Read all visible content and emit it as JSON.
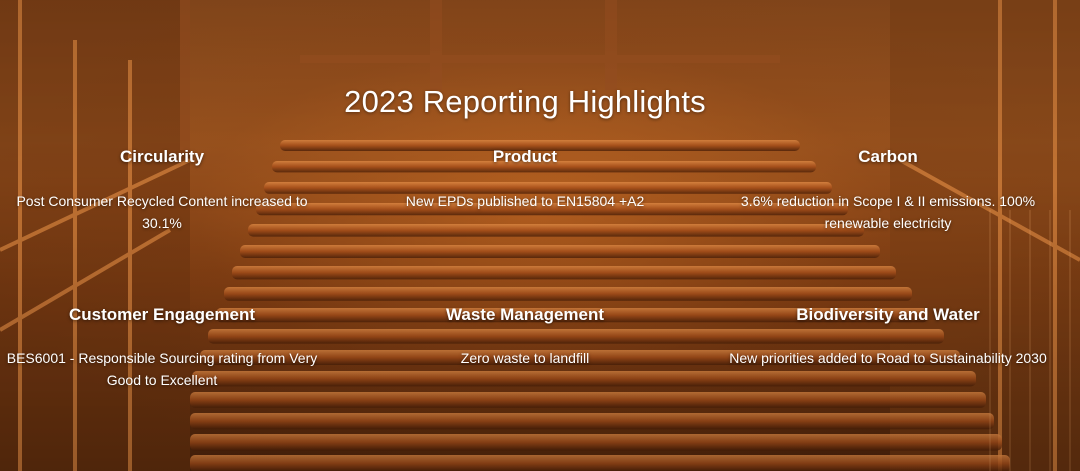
{
  "title": "2023 Reporting Highlights",
  "highlights": [
    {
      "heading": "Circularity",
      "text": "Post Consumer Recycled Content increased to 30.1%"
    },
    {
      "heading": "Product",
      "text": "New EPDs published to EN15804 +A2"
    },
    {
      "heading": "Carbon",
      "text": "3.6% reduction in Scope I & II emissions. 100% renewable electricity"
    },
    {
      "heading": "Customer Engagement",
      "text": "BES6001 - Responsible Sourcing rating from Very Good to Excellent"
    },
    {
      "heading": "Waste Management",
      "text": "Zero waste to landfill"
    },
    {
      "heading": "Biodiversity and Water",
      "text": "New priorities added to Road to Sustainability 2030"
    }
  ],
  "colors": {
    "accent": "#c8661f",
    "text": "#ffffff"
  },
  "background": "factory-rollers-photo"
}
